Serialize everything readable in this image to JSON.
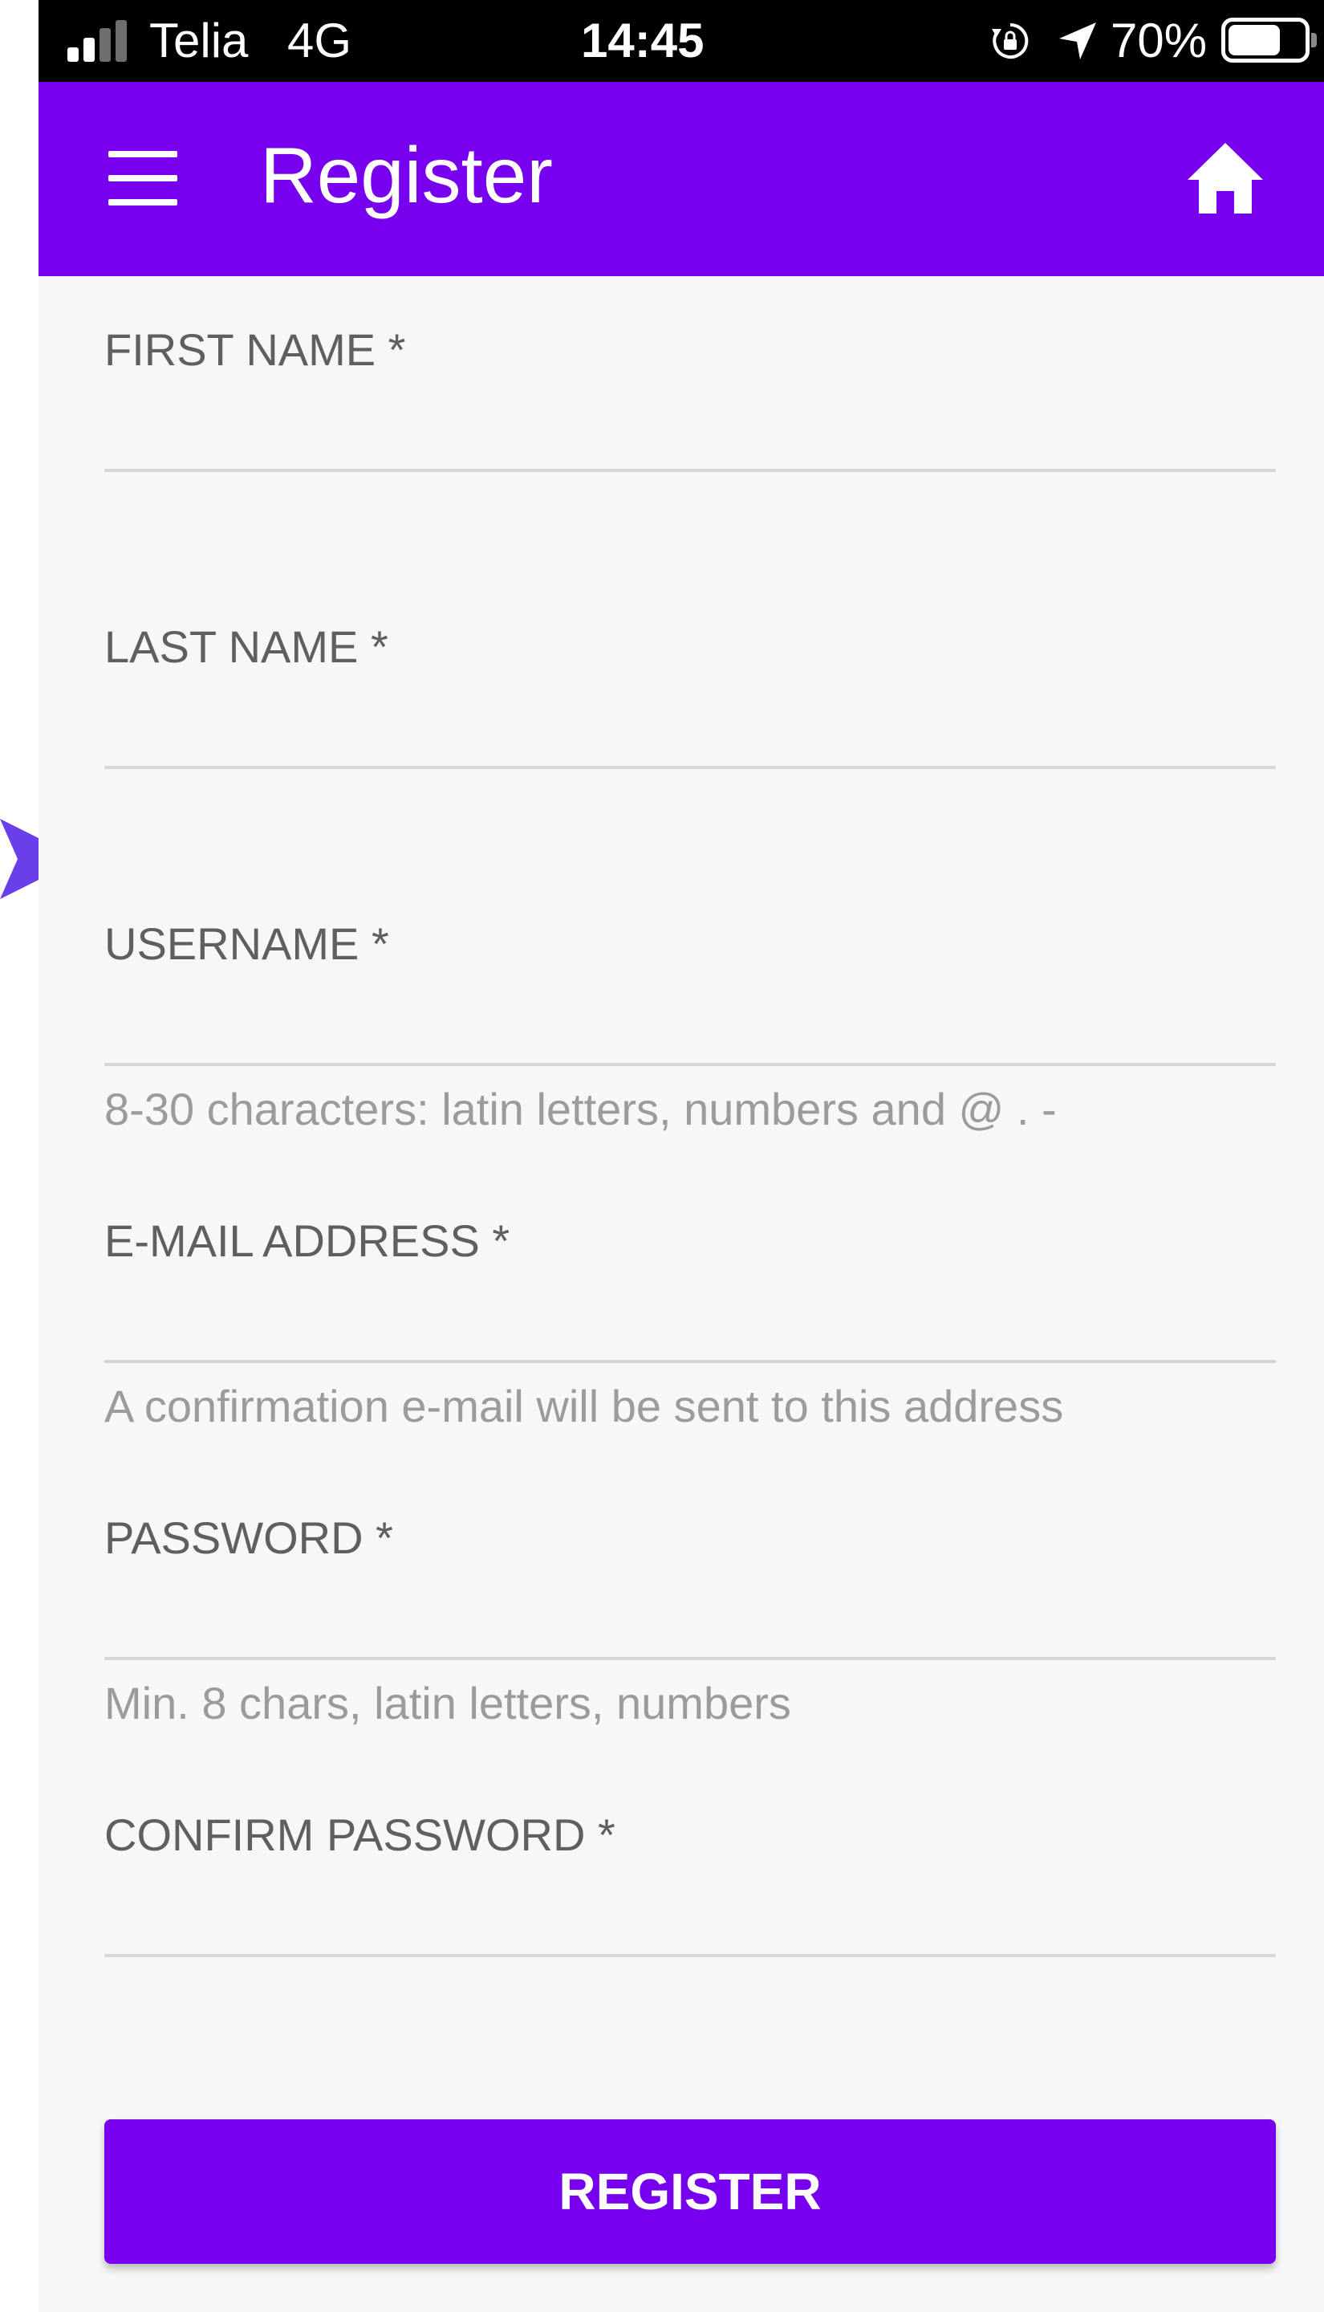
{
  "status_bar": {
    "carrier": "Telia",
    "network": "4G",
    "time": "14:45",
    "battery_percent_text": "70%",
    "battery_level": 0.7,
    "signal_bars_active": 2,
    "signal_bars_total": 4,
    "icons": [
      "signal-icon",
      "orientation-lock-icon",
      "location-arrow-icon",
      "battery-icon"
    ]
  },
  "app_bar": {
    "title": "Register",
    "background_color": "#7700ee",
    "icons": [
      "hamburger-menu-icon",
      "home-icon"
    ]
  },
  "form": {
    "fields": [
      {
        "label": "FIRST NAME *",
        "value": "",
        "hint": ""
      },
      {
        "label": "LAST NAME *",
        "value": "",
        "hint": ""
      },
      {
        "label": "USERNAME *",
        "value": "",
        "hint": "8-30 characters: latin letters, numbers and @ . -"
      },
      {
        "label": "E-MAIL ADDRESS *",
        "value": "",
        "hint": "A confirmation e-mail will be sent to this address"
      },
      {
        "label": "PASSWORD *",
        "value": "",
        "hint": "Min. 8 chars, latin letters, numbers"
      },
      {
        "label": "CONFIRM PASSWORD *",
        "value": "",
        "hint": ""
      }
    ],
    "submit_label": "REGISTER"
  },
  "annotation": {
    "icon": "pointer-arrow-icon",
    "color": "#6a3ee8"
  }
}
